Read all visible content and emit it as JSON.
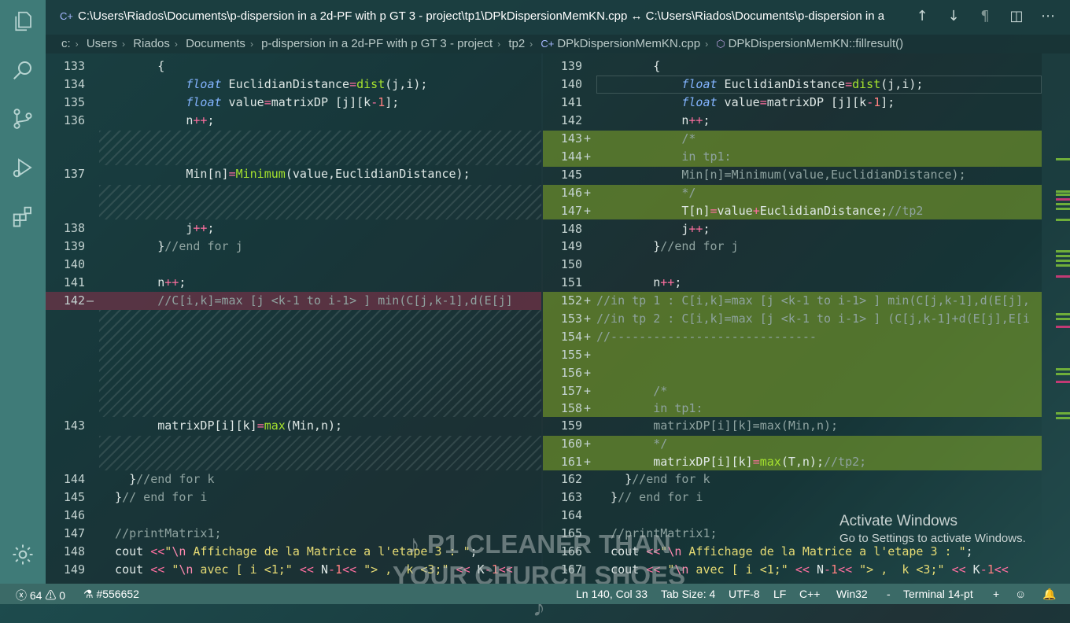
{
  "title_bar": {
    "title": "C:\\Users\\Riados\\Documents\\p-dispersion in a 2d-PF with p GT 3 - project\\tp1\\DPkDispersionMemKN.cpp ↔ C:\\Users\\Riados\\Documents\\p-dispersion in a",
    "actions": [
      "previous-change",
      "next-change",
      "toggle-whitespace",
      "split-editor",
      "more-actions"
    ]
  },
  "breadcrumb": {
    "items": [
      "c:",
      "Users",
      "Riados",
      "Documents",
      "p-dispersion in a 2d-PF with p GT 3 - project",
      "tp2",
      "DPkDispersionMemKN.cpp",
      "DPkDispersionMemKN::fillresult()"
    ]
  },
  "activity_bar": [
    "explorer-icon",
    "search-icon",
    "source-control-icon",
    "run-debug-icon",
    "extensions-icon",
    "settings-gear-icon"
  ],
  "left_editor": {
    "lines": [
      {
        "n": "133",
        "t": "        {"
      },
      {
        "n": "134",
        "t": "            float EuclidianDistance=dist(j,i);"
      },
      {
        "n": "135",
        "t": "            float value=matrixDP [j][k-1];"
      },
      {
        "n": "136",
        "t": "            n++;"
      },
      {
        "n": "137",
        "t": "            Min[n]=Minimum(value,EuclidianDistance);"
      },
      {
        "n": "138",
        "t": "            j++;"
      },
      {
        "n": "139",
        "t": "        }//end for j"
      },
      {
        "n": "140",
        "t": ""
      },
      {
        "n": "141",
        "t": "        n++;"
      },
      {
        "n": "142",
        "m": "—",
        "t": "        //C[i,k]=max [j <k-1 to i-1> ] min(C[j,k-1],d(E[j]"
      },
      {
        "n": "143",
        "t": "        matrixDP[i][k]=max(Min,n);"
      },
      {
        "n": "144",
        "t": "    }//end for k"
      },
      {
        "n": "145",
        "t": "  }// end for i"
      },
      {
        "n": "146",
        "t": ""
      },
      {
        "n": "147",
        "t": "  //printMatrix1;"
      },
      {
        "n": "148",
        "t": "  cout <<\"\\n Affichage de la Matrice a l'etape 3 : \";"
      },
      {
        "n": "149",
        "t": "  cout << \"\\n avec [ i <1;\" << N-1<< \"> ,  k <3;\" << K-1<<"
      }
    ]
  },
  "right_editor": {
    "lines": [
      {
        "n": "139",
        "t": "        {"
      },
      {
        "n": "140",
        "t": "            float EuclidianDistance=dist(j,i);"
      },
      {
        "n": "141",
        "t": "            float value=matrixDP [j][k-1];"
      },
      {
        "n": "142",
        "t": "            n++;"
      },
      {
        "n": "143",
        "m": "+",
        "t": "            /*"
      },
      {
        "n": "144",
        "m": "+",
        "t": "            in tp1:"
      },
      {
        "n": "145",
        "t": "            Min[n]=Minimum(value,EuclidianDistance);"
      },
      {
        "n": "146",
        "m": "+",
        "t": "            */"
      },
      {
        "n": "147",
        "m": "+",
        "t": "            T[n]=value+EuclidianDistance;//tp2"
      },
      {
        "n": "148",
        "t": "            j++;"
      },
      {
        "n": "149",
        "t": "        }//end for j"
      },
      {
        "n": "150",
        "t": ""
      },
      {
        "n": "151",
        "t": "        n++;"
      },
      {
        "n": "152",
        "m": "+",
        "t": "//in tp 1 : C[i,k]=max [j <k-1 to i-1> ] min(C[j,k-1],d(E[j],"
      },
      {
        "n": "153",
        "m": "+",
        "t": "//in tp 2 : C[i,k]=max [j <k-1 to i-1> ] (C[j,k-1]+d(E[j],E[i"
      },
      {
        "n": "154",
        "m": "+",
        "t": "//-----------------------------"
      },
      {
        "n": "155",
        "m": "+",
        "t": ""
      },
      {
        "n": "156",
        "m": "+",
        "t": ""
      },
      {
        "n": "157",
        "m": "+",
        "t": "        /*"
      },
      {
        "n": "158",
        "m": "+",
        "t": "        in tp1:"
      },
      {
        "n": "159",
        "t": "        matrixDP[i][k]=max(Min,n);"
      },
      {
        "n": "160",
        "m": "+",
        "t": "        */"
      },
      {
        "n": "161",
        "m": "+",
        "t": "        matrixDP[i][k]=max(T,n);//tp2;"
      },
      {
        "n": "162",
        "t": "    }//end for k"
      },
      {
        "n": "163",
        "t": "  }// end for i"
      },
      {
        "n": "164",
        "t": ""
      },
      {
        "n": "165",
        "t": "  //printMatrix1;"
      },
      {
        "n": "166",
        "t": "  cout <<\"\\n Affichage de la Matrice a l'etape 3 : \";"
      },
      {
        "n": "167",
        "t": "  cout << \"\\n avec [ i <1;\" << N-1<< \"> ,  k <3;\" << K-1<<"
      }
    ]
  },
  "watermark": {
    "line1": "Activate Windows",
    "line2": "Go to Settings to activate Windows."
  },
  "overlay_caption": "♪ P1 CLEANER THAN YOUR CHURCH SHOES ♪",
  "status_bar": {
    "errors": "64",
    "warnings": "0",
    "remote": "#556652",
    "position": "Ln 140, Col 33",
    "tab_size": "Tab Size: 4",
    "encoding": "UTF-8",
    "eol": "LF",
    "language": "C++",
    "platform": "Win32",
    "dash": "-",
    "terminal": "Terminal 14-pt",
    "plus": "+"
  },
  "colors": {
    "activity_bar": "#3f7b78",
    "status_bar": "#3b6a67",
    "added": "#789b28",
    "removed": "#8c324b"
  }
}
